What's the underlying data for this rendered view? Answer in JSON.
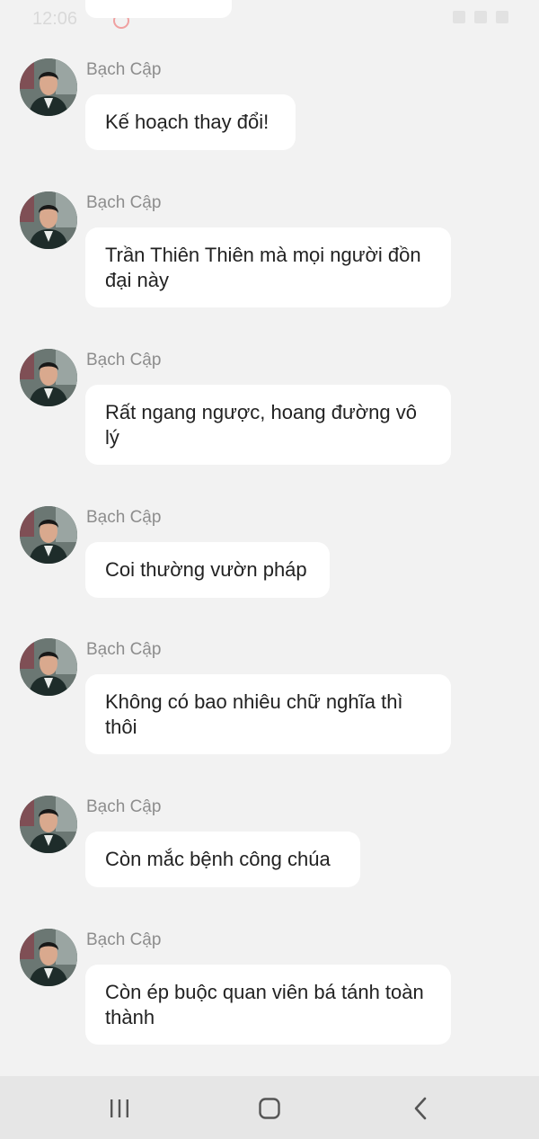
{
  "status_bar": {
    "time": "12:06"
  },
  "sender_name": "Bạch Cập",
  "messages": [
    {
      "text": "Kế hoạch thay đổi!"
    },
    {
      "text": "Trần Thiên Thiên mà mọi người đồn đại này"
    },
    {
      "text": "Rất ngang ngược, hoang đường vô lý"
    },
    {
      "text": "Coi thường vườn pháp"
    },
    {
      "text": "Không có bao nhiêu chữ nghĩa thì thôi"
    },
    {
      "text": "Còn mắc bệnh công chúa"
    },
    {
      "text": "Còn ép buộc quan viên bá tánh toàn thành"
    }
  ],
  "icons": {
    "status": "peach-icon",
    "nav": [
      "recent-apps-icon",
      "home-icon",
      "back-icon"
    ]
  },
  "colors": {
    "background": "#f2f2f2",
    "bubble": "#ffffff",
    "sender": "#8d8d8d",
    "navbar": "#e6e6e6"
  }
}
